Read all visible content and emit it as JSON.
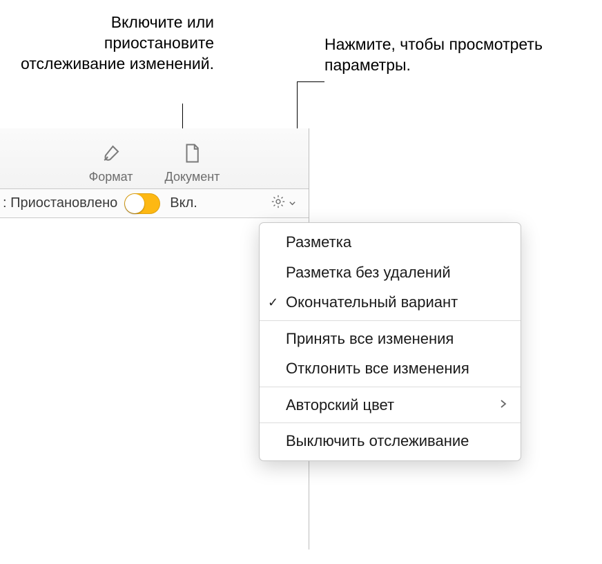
{
  "callouts": {
    "left": "Включите или приостановите отслеживание изменений.",
    "right": "Нажмите, чтобы просмотреть параметры."
  },
  "toolbar": {
    "format_label": "Формат",
    "document_label": "Документ"
  },
  "track_bar": {
    "status_label": ": Приостановлено",
    "on_label": "Вкл."
  },
  "popup": {
    "items": [
      {
        "label": "Разметка",
        "checked": false,
        "submenu": false
      },
      {
        "label": "Разметка без удалений",
        "checked": false,
        "submenu": false
      },
      {
        "label": "Окончательный вариант",
        "checked": true,
        "submenu": false
      }
    ],
    "items2": [
      {
        "label": "Принять все изменения",
        "checked": false,
        "submenu": false
      },
      {
        "label": "Отклонить все изменения",
        "checked": false,
        "submenu": false
      }
    ],
    "items3": [
      {
        "label": "Авторский цвет",
        "checked": false,
        "submenu": true
      }
    ],
    "items4": [
      {
        "label": "Выключить отслеживание",
        "checked": false,
        "submenu": false
      }
    ]
  }
}
